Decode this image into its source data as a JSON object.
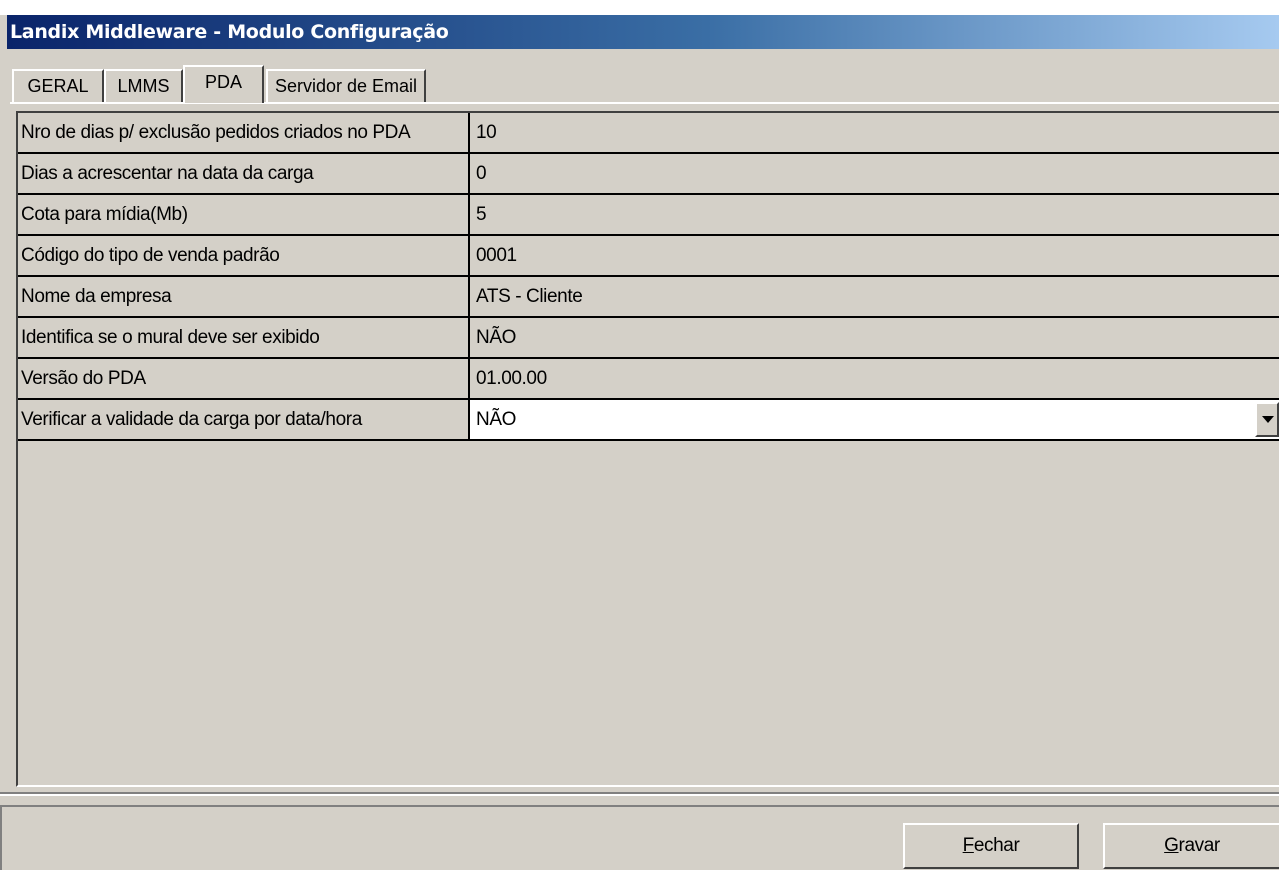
{
  "window": {
    "title": "Landix Middleware - Modulo Configuração"
  },
  "tabs": [
    {
      "label": "GERAL"
    },
    {
      "label": "LMMS"
    },
    {
      "label": "PDA"
    },
    {
      "label": "Servidor de Email"
    }
  ],
  "active_tab": "PDA",
  "settings": [
    {
      "name": "Nro de dias p/ exclusão pedidos criados no PDA",
      "value": "10"
    },
    {
      "name": "Dias a acrescentar na data da carga",
      "value": "0"
    },
    {
      "name": "Cota para mídia(Mb)",
      "value": "5"
    },
    {
      "name": "Código do tipo de venda padrão",
      "value": "0001"
    },
    {
      "name": "Nome da empresa",
      "value": "ATS - Cliente"
    },
    {
      "name": "Identifica se o mural deve ser exibido",
      "value": "NÃO"
    },
    {
      "name": "Versão do PDA",
      "value": "01.00.00"
    },
    {
      "name": "Verificar a validade da carga por data/hora",
      "value": "NÃO"
    }
  ],
  "buttons": {
    "close": {
      "accel": "F",
      "rest": "echar"
    },
    "save": {
      "accel": "G",
      "rest": "ravar"
    }
  },
  "icons": {
    "dropdown": "chevron-down-icon"
  }
}
